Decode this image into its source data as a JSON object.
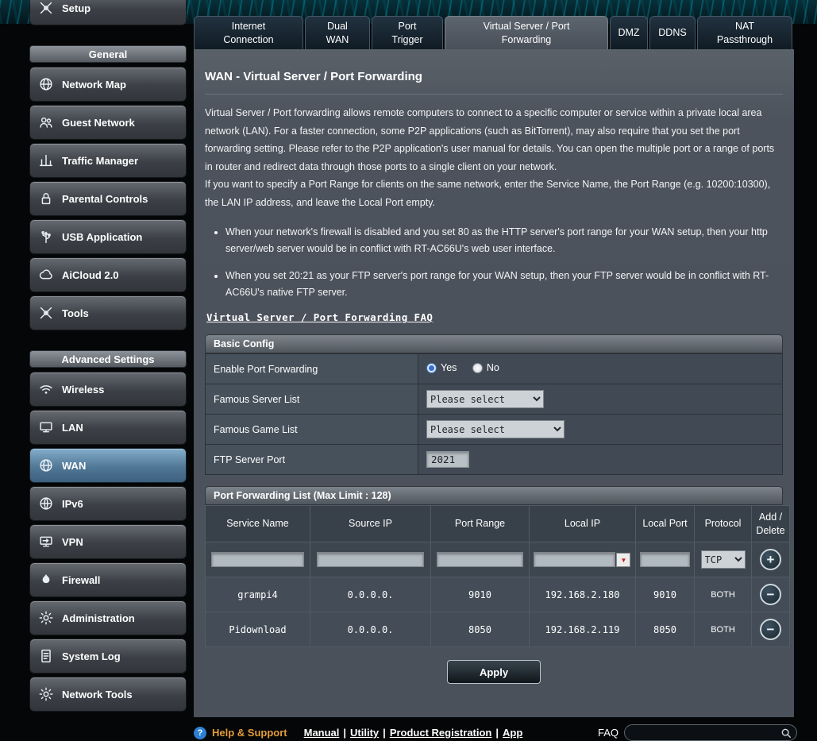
{
  "sidebar": {
    "setup": {
      "label": "Setup"
    },
    "sections": [
      {
        "title": "General",
        "items": [
          {
            "label": "Network Map",
            "icon": "globe-icon"
          },
          {
            "label": "Guest Network",
            "icon": "people-icon"
          },
          {
            "label": "Traffic Manager",
            "icon": "chart-bars-icon"
          },
          {
            "label": "Parental Controls",
            "icon": "lock-icon"
          },
          {
            "label": "USB Application",
            "icon": "usb-icon"
          },
          {
            "label": "AiCloud 2.0",
            "icon": "cloud-icon"
          },
          {
            "label": "Tools",
            "icon": "wrench-icon"
          }
        ]
      },
      {
        "title": "Advanced Settings",
        "items": [
          {
            "label": "Wireless",
            "icon": "wifi-icon"
          },
          {
            "label": "LAN",
            "icon": "monitor-icon"
          },
          {
            "label": "WAN",
            "icon": "globe-icon",
            "active": true
          },
          {
            "label": "IPv6",
            "icon": "ipv6-icon"
          },
          {
            "label": "VPN",
            "icon": "vpn-icon"
          },
          {
            "label": "Firewall",
            "icon": "flame-icon"
          },
          {
            "label": "Administration",
            "icon": "gear-person-icon"
          },
          {
            "label": "System Log",
            "icon": "document-icon"
          },
          {
            "label": "Network Tools",
            "icon": "gear-icon"
          }
        ]
      }
    ]
  },
  "tabs": [
    {
      "label": "Internet\nConnection"
    },
    {
      "label": "Dual\nWAN"
    },
    {
      "label": "Port\nTrigger"
    },
    {
      "label": "Virtual Server / Port\nForwarding",
      "active": true
    },
    {
      "label": "DMZ"
    },
    {
      "label": "DDNS"
    },
    {
      "label": "NAT\nPassthrough"
    }
  ],
  "main": {
    "title": "WAN - Virtual Server / Port Forwarding",
    "paragraphs": [
      "Virtual Server / Port forwarding allows remote computers to connect to a specific computer or service within a private local area network (LAN). For a faster connection, some P2P applications (such as BitTorrent), may also require that you set the port forwarding setting. Please refer to the P2P application's user manual for details. You can open the multiple port or a range of ports in router and redirect data through those ports to a single client on your network.",
      "If you want to specify a Port Range for clients on the same network, enter the Service Name, the Port Range (e.g. 10200:10300), the LAN IP address, and leave the Local Port empty."
    ],
    "bullets": [
      "When your network's firewall is disabled and you set 80 as the HTTP server's port range for your WAN setup, then your http server/web server would be in conflict with RT-AC66U's web user interface.",
      "When you set 20:21 as your FTP server's port range for your WAN setup, then your FTP server would be in conflict with RT-AC66U's native FTP server."
    ],
    "faq_link": "Virtual Server / Port Forwarding FAQ",
    "basic_config": {
      "title": "Basic Config",
      "enable_label": "Enable Port Forwarding",
      "yes_label": "Yes",
      "no_label": "No",
      "famous_server_label": "Famous Server List",
      "famous_server_value": "Please select",
      "famous_game_label": "Famous Game List",
      "famous_game_value": "Please select",
      "ftp_port_label": "FTP Server Port",
      "ftp_port_value": "2021"
    },
    "port_forwarding": {
      "title": "Port Forwarding List (Max Limit : 128)",
      "headers": [
        "Service Name",
        "Source IP",
        "Port Range",
        "Local IP",
        "Local Port",
        "Protocol",
        "Add /\nDelete"
      ],
      "new_row_protocol": "TCP",
      "rows": [
        {
          "service_name": "grampi4",
          "source_ip": "0.0.0.0.",
          "port_range": "9010",
          "local_ip": "192.168.2.180",
          "local_port": "9010",
          "protocol": "BOTH"
        },
        {
          "service_name": "Pidownload",
          "source_ip": "0.0.0.0.",
          "port_range": "8050",
          "local_ip": "192.168.2.119",
          "local_port": "8050",
          "protocol": "BOTH"
        }
      ]
    },
    "apply_label": "Apply"
  },
  "footer": {
    "help_label": "Help & Support",
    "links": [
      "Manual",
      "Utility",
      "Product Registration",
      "App"
    ],
    "faq_label": "FAQ"
  },
  "icons": {
    "dropdown_arrow": "▼",
    "add_symbol": "+",
    "delete_symbol": "−",
    "help_symbol": "?",
    "link_separator": "|"
  },
  "colors": {
    "accent_selected_nav": "#517896",
    "panel_background": "#4c535c",
    "help_label": "#e39b3b",
    "combo_arrow": "#c21d1d",
    "radio_checked": "#2f6fd8"
  }
}
